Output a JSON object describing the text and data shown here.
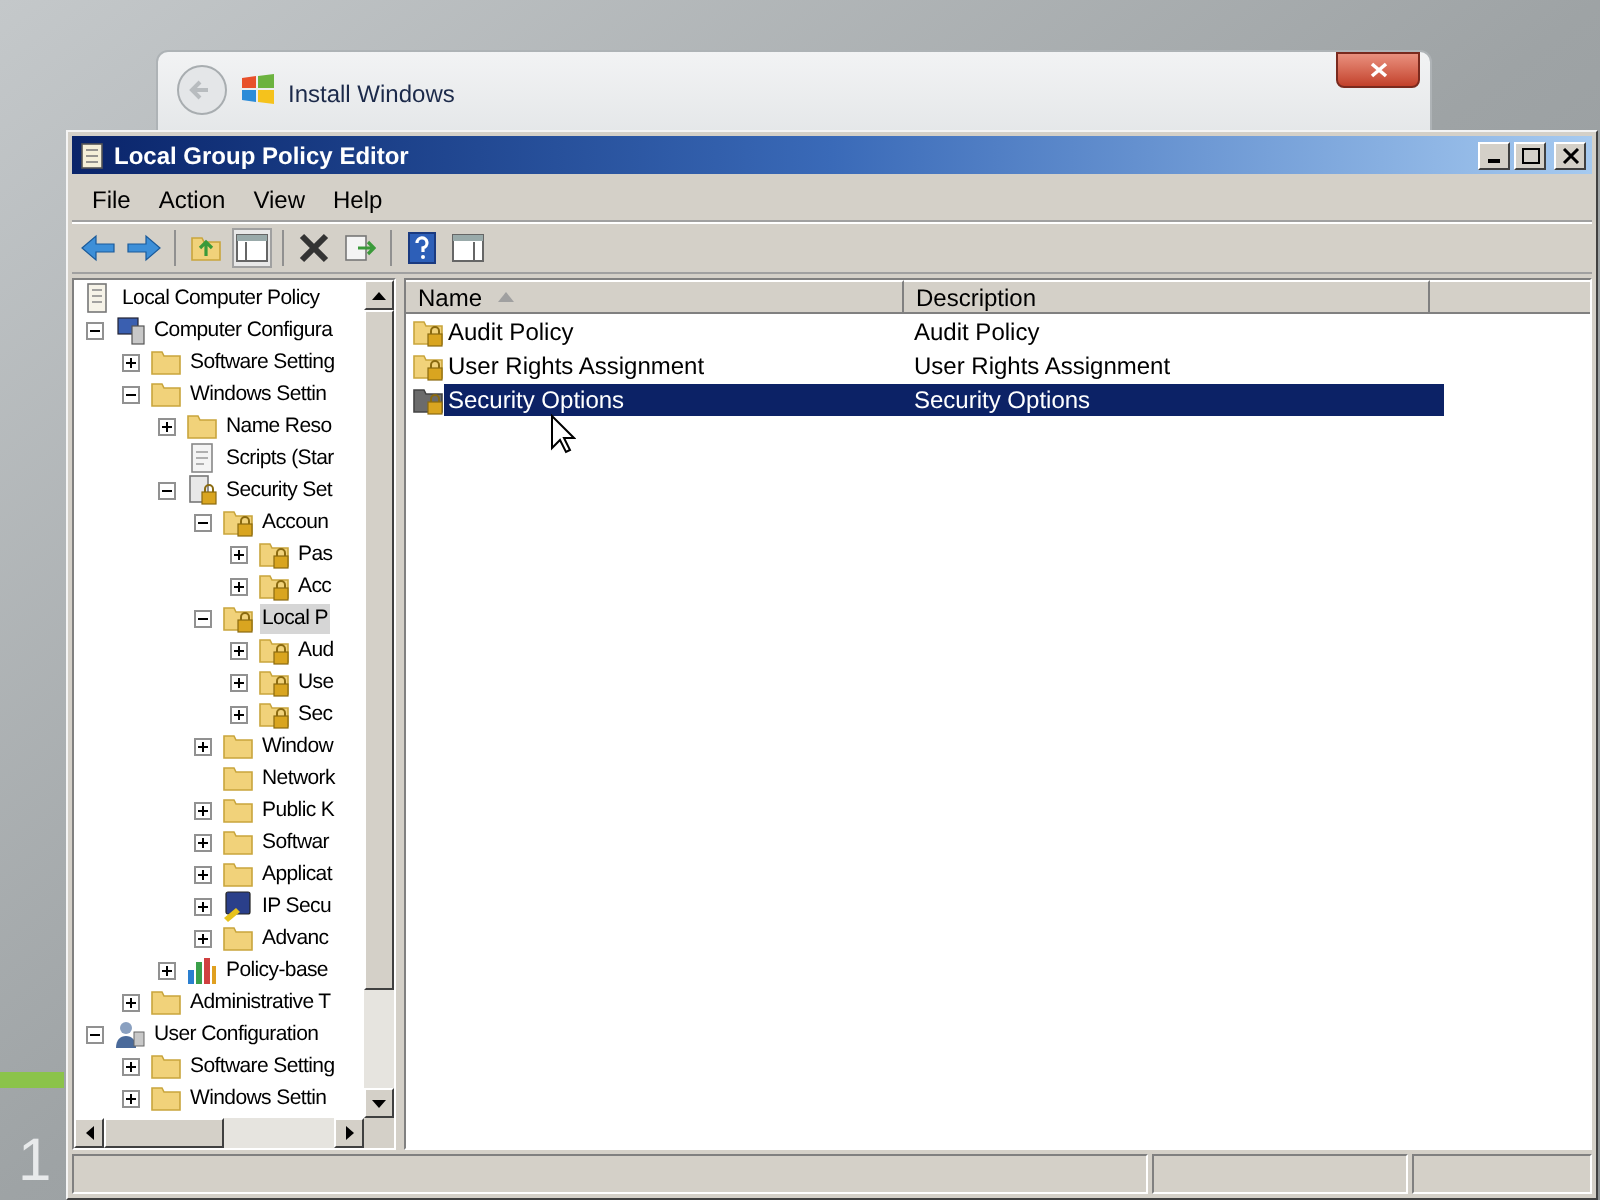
{
  "background_window": {
    "title": "Install Windows"
  },
  "window": {
    "title": "Local Group Policy Editor"
  },
  "menu": [
    "File",
    "Action",
    "View",
    "Help"
  ],
  "tree": [
    {
      "label": "Local Computer Policy",
      "kind": "policy",
      "selected": false,
      "children": [
        {
          "label": "Computer Configura",
          "kind": "computer",
          "selected": false,
          "expanded": true,
          "children": [
            {
              "label": "Software Setting",
              "kind": "folder",
              "selected": false,
              "expanded": false
            },
            {
              "label": "Windows Settin",
              "kind": "folder",
              "selected": false,
              "expanded": true,
              "children": [
                {
                  "label": "Name Reso",
                  "kind": "folder",
                  "selected": false,
                  "expanded": false
                },
                {
                  "label": "Scripts (Star",
                  "kind": "script",
                  "selected": false
                },
                {
                  "label": "Security Set",
                  "kind": "security",
                  "selected": false,
                  "expanded": true,
                  "children": [
                    {
                      "label": "Accoun",
                      "kind": "secure-folder",
                      "selected": false,
                      "expanded": true,
                      "children": [
                        {
                          "label": "Pas",
                          "kind": "secure-folder",
                          "selected": false,
                          "expanded": false
                        },
                        {
                          "label": "Acc",
                          "kind": "secure-folder",
                          "selected": false,
                          "expanded": false
                        }
                      ]
                    },
                    {
                      "label": "Local P",
                      "kind": "secure-folder",
                      "selected": true,
                      "expanded": true,
                      "children": [
                        {
                          "label": "Aud",
                          "kind": "secure-folder",
                          "selected": false,
                          "expanded": false
                        },
                        {
                          "label": "Use",
                          "kind": "secure-folder",
                          "selected": false,
                          "expanded": false
                        },
                        {
                          "label": "Sec",
                          "kind": "secure-folder",
                          "selected": false,
                          "expanded": false
                        }
                      ]
                    },
                    {
                      "label": "Window",
                      "kind": "folder",
                      "selected": false,
                      "expanded": false
                    },
                    {
                      "label": "Network",
                      "kind": "folder",
                      "selected": false
                    },
                    {
                      "label": "Public K",
                      "kind": "folder",
                      "selected": false,
                      "expanded": false
                    },
                    {
                      "label": "Softwar",
                      "kind": "folder",
                      "selected": false,
                      "expanded": false
                    },
                    {
                      "label": "Applicat",
                      "kind": "folder",
                      "selected": false,
                      "expanded": false
                    },
                    {
                      "label": "IP Secu",
                      "kind": "shield",
                      "selected": false,
                      "expanded": false
                    },
                    {
                      "label": "Advanc",
                      "kind": "folder",
                      "selected": false,
                      "expanded": false
                    }
                  ]
                },
                {
                  "label": "Policy-base",
                  "kind": "chart",
                  "selected": false,
                  "expanded": false
                }
              ]
            },
            {
              "label": "Administrative T",
              "kind": "folder",
              "selected": false,
              "expanded": false
            }
          ]
        },
        {
          "label": "User Configuration",
          "kind": "user",
          "selected": false,
          "expanded": true,
          "children": [
            {
              "label": "Software Setting",
              "kind": "folder",
              "selected": false,
              "expanded": false
            },
            {
              "label": "Windows Settin",
              "kind": "folder",
              "selected": false,
              "expanded": false
            }
          ]
        }
      ]
    }
  ],
  "list": {
    "columns": [
      {
        "label": "Name",
        "sorted": true
      },
      {
        "label": "Description",
        "sorted": false
      }
    ],
    "rows": [
      {
        "name": "Audit Policy",
        "description": "Audit Policy",
        "kind": "secure-folder",
        "selected": false
      },
      {
        "name": "User Rights Assignment",
        "description": "User Rights Assignment",
        "kind": "secure-folder",
        "selected": false
      },
      {
        "name": "Security Options",
        "description": "Security Options",
        "kind": "gray-folder",
        "selected": true
      }
    ]
  },
  "side_label": "1"
}
